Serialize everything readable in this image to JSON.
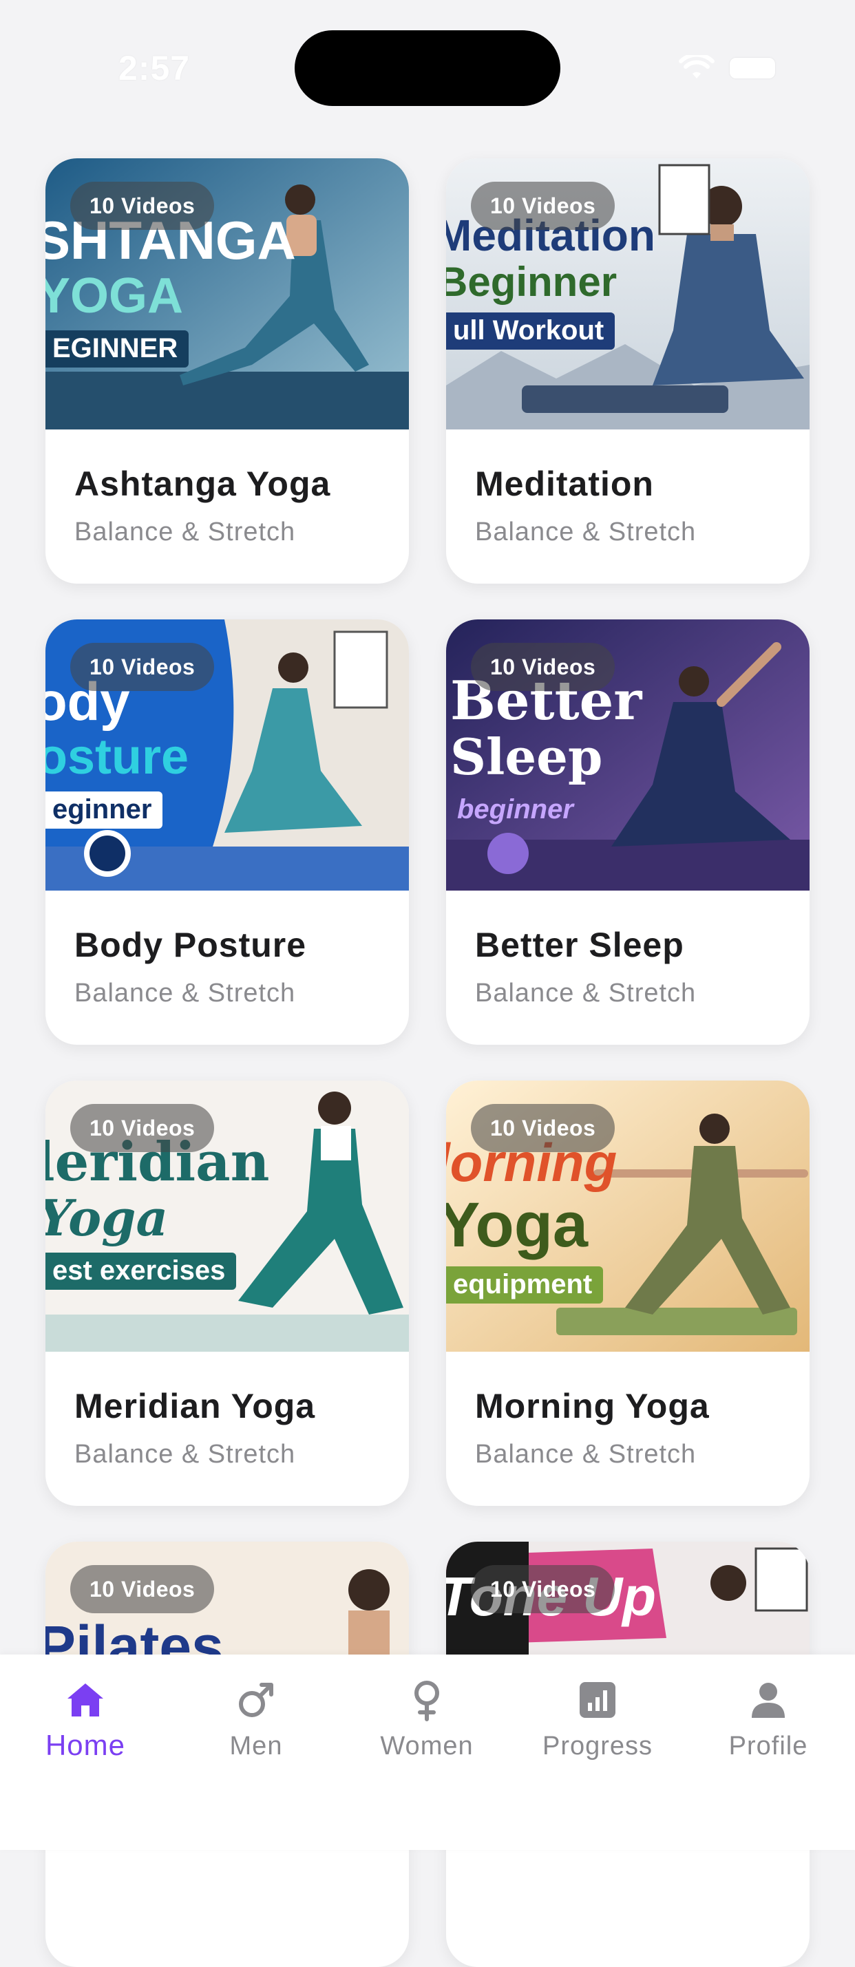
{
  "status": {
    "time": "2:57"
  },
  "cards": [
    {
      "badge": "10 Videos",
      "title": "Ashtanga Yoga",
      "subtitle": "Balance & Stretch",
      "thumb": {
        "line1": "SHTANGA",
        "line2": "YOGA",
        "line3": "EGINNER",
        "bg1": "#1e5b86",
        "bg2": "#7fb3c9",
        "text1": "#ffffff",
        "text2": "#7ee0d7",
        "tag_bg": "#2fb7c9"
      }
    },
    {
      "badge": "10 Videos",
      "title": "Meditation",
      "subtitle": "Balance & Stretch",
      "thumb": {
        "line1": "Meditation",
        "line2": "Beginner",
        "line3": "ull Workout",
        "bg1": "#e9eef2",
        "bg2": "#c7d2dc",
        "text1": "#1e3c79",
        "text2": "#2f6a2c",
        "tag_bg": "#1e3c79"
      }
    },
    {
      "badge": "10 Videos",
      "title": "Body Posture",
      "subtitle": "Balance & Stretch",
      "thumb": {
        "line1": "ody",
        "line2": "osture",
        "line3": "eginner",
        "bg1": "#1a64c8",
        "bg2": "#e9e5df",
        "text1": "#ffffff",
        "text2": "#2fd0e0",
        "tag_bg": "#0f2f66"
      }
    },
    {
      "badge": "10 Videos",
      "title": "Better Sleep",
      "subtitle": "Balance & Stretch",
      "thumb": {
        "line1": "Better",
        "line2": "Sleep",
        "line3": "beginner",
        "bg1": "#2c2a63",
        "bg2": "#6a4fa3",
        "text1": "#ffffff",
        "text2": "#ffffff",
        "tag_bg": "#8a6ad6"
      }
    },
    {
      "badge": "10 Videos",
      "title": "Meridian Yoga",
      "subtitle": "Balance & Stretch",
      "thumb": {
        "line1": "leridian",
        "line2": "Yoga",
        "line3": "est exercises",
        "bg1": "#f5f2ee",
        "bg2": "#dde6e4",
        "text1": "#1d6b68",
        "text2": "#1d6b68",
        "tag_bg": "#1d6b68"
      }
    },
    {
      "badge": "10 Videos",
      "title": "Morning Yoga",
      "subtitle": "Balance & Stretch",
      "thumb": {
        "line1": "lorning",
        "line2": "Yoga",
        "line3": "equipment",
        "bg1": "#fbe7c9",
        "bg2": "#e9c48a",
        "text1": "#e0522a",
        "text2": "#3e5b1c",
        "tag_bg": "#7aa33a"
      }
    },
    {
      "badge": "10 Videos",
      "title": "",
      "subtitle": "",
      "thumb": {
        "line1": "",
        "line2": "Pilates",
        "line3": "",
        "bg1": "#f4ece2",
        "bg2": "#e4d2bf",
        "text1": "#1f3a8a",
        "text2": "#1f3a8a",
        "tag_bg": "#1f3a8a"
      }
    },
    {
      "badge": "10 Videos",
      "title": "",
      "subtitle": "",
      "thumb": {
        "line1": "",
        "line2": "Tone Up",
        "line3": "",
        "bg1": "#1a1a1a",
        "bg2": "#d94a8a",
        "text1": "#ffffff",
        "text2": "#ffffff",
        "tag_bg": "#d94a8a"
      }
    }
  ],
  "tabs": [
    {
      "label": "Home",
      "icon": "house-icon",
      "active": true
    },
    {
      "label": "Men",
      "icon": "male-symbol-icon",
      "active": false
    },
    {
      "label": "Women",
      "icon": "female-symbol-icon",
      "active": false
    },
    {
      "label": "Progress",
      "icon": "chart-icon",
      "active": false
    },
    {
      "label": "Profile",
      "icon": "person-icon",
      "active": false
    }
  ],
  "colors": {
    "accent": "#7b3ff2",
    "inactive": "#8a8a8e",
    "background": "#f3f3f5"
  }
}
